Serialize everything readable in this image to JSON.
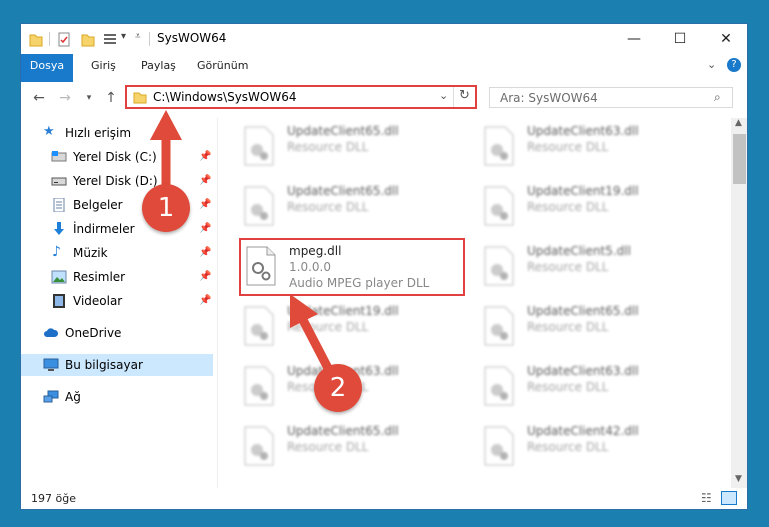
{
  "window": {
    "title": "SysWOW64"
  },
  "ribbon": {
    "tabs": [
      "Dosya",
      "Giriş",
      "Paylaş",
      "Görünüm"
    ]
  },
  "address": {
    "path": "C:\\Windows\\SysWOW64"
  },
  "search": {
    "placeholder": "Ara: SysWOW64"
  },
  "sidebar": {
    "items": [
      {
        "label": "Hızlı erişim",
        "icon": "star-icon"
      },
      {
        "label": "Yerel Disk (C:)",
        "icon": "drive-icon"
      },
      {
        "label": "Yerel Disk (D:)",
        "icon": "drive-icon"
      },
      {
        "label": "Belgeler",
        "icon": "documents-icon"
      },
      {
        "label": "İndirmeler",
        "icon": "download-icon"
      },
      {
        "label": "Müzik",
        "icon": "music-icon"
      },
      {
        "label": "Resimler",
        "icon": "pictures-icon"
      },
      {
        "label": "Videolar",
        "icon": "videos-icon"
      },
      {
        "label": "OneDrive",
        "icon": "cloud-icon"
      },
      {
        "label": "Bu bilgisayar",
        "icon": "computer-icon"
      },
      {
        "label": "Ağ",
        "icon": "network-icon"
      }
    ]
  },
  "files": [
    {
      "name": "UpdateClient65.dll",
      "desc": "Resource DLL"
    },
    {
      "name": "UpdateClient63.dll",
      "desc": "Resource DLL"
    },
    {
      "name": "UpdateClient65.dll",
      "desc": "Resource DLL"
    },
    {
      "name": "UpdateClient19.dll",
      "desc": "Resource DLL"
    },
    {
      "name": "mpeg.dll",
      "version": "1.0.0.0",
      "desc": "Audio MPEG player DLL"
    },
    {
      "name": "UpdateClient5.dll",
      "desc": "Resource DLL"
    },
    {
      "name": "UpdateClient19.dll",
      "desc": "Resource DLL"
    },
    {
      "name": "UpdateClient65.dll",
      "desc": "Resource DLL"
    },
    {
      "name": "UpdateClient63.dll",
      "desc": "Resource DLL"
    },
    {
      "name": "UpdateClient63.dll",
      "desc": "Resource DLL"
    },
    {
      "name": "UpdateClient65.dll",
      "desc": "Resource DLL"
    },
    {
      "name": "UpdateClient42.dll",
      "desc": "Resource DLL"
    }
  ],
  "status": {
    "count": "197 öğe"
  },
  "callouts": [
    "1",
    "2"
  ],
  "colors": {
    "accent": "#1979ca",
    "highlight": "#e04040",
    "desktop": "#1b7fb0"
  }
}
